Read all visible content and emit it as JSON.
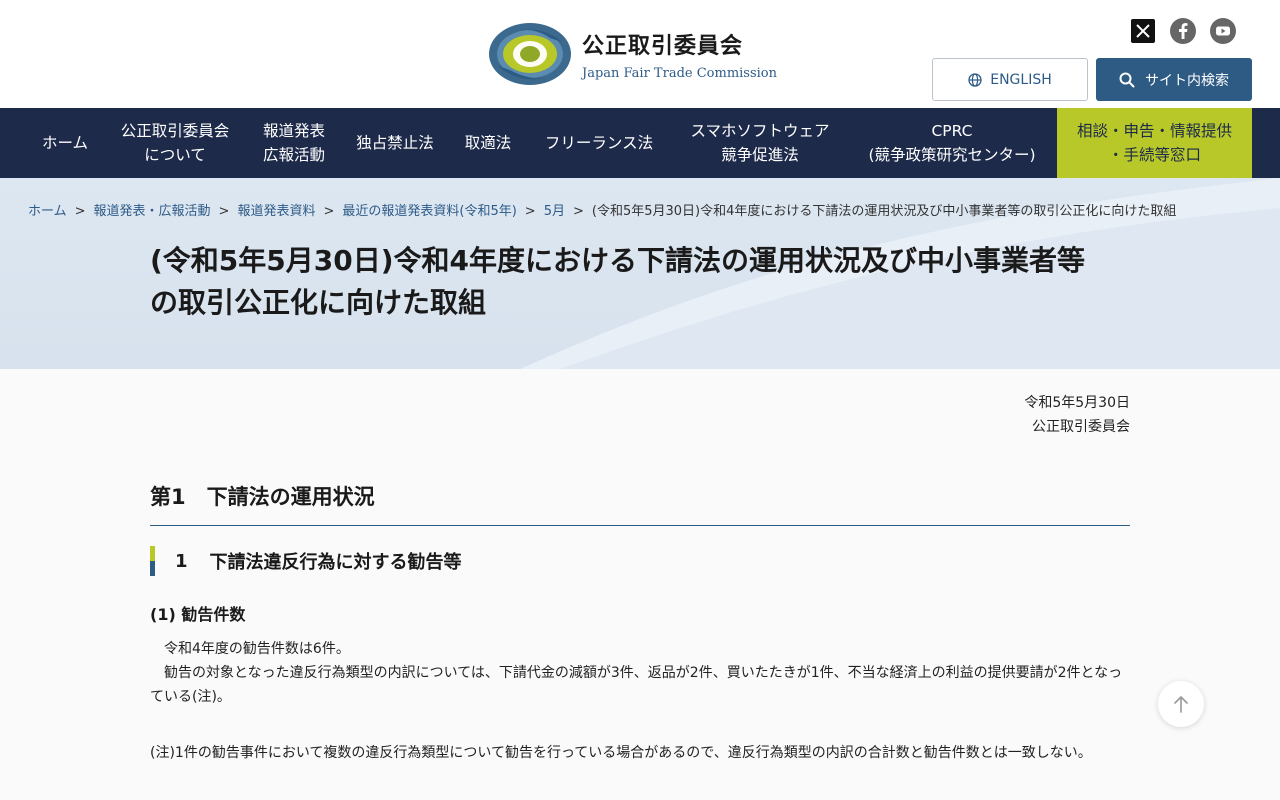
{
  "header": {
    "org_name_ja": "公正取引委員会",
    "org_name_en": "Japan Fair Trade Commission",
    "logo_ring_text": "JAPAN FAIR TRADE COMMISSION",
    "english_button": "ENGLISH",
    "search_button": "サイト内検索",
    "social": [
      "x-icon",
      "facebook-icon",
      "youtube-icon"
    ]
  },
  "nav": {
    "items": [
      {
        "line1": "ホーム",
        "line2": ""
      },
      {
        "line1": "公正取引委員会",
        "line2": "について"
      },
      {
        "line1": "報道発表",
        "line2": "広報活動"
      },
      {
        "line1": "独占禁止法",
        "line2": ""
      },
      {
        "line1": "取適法",
        "line2": ""
      },
      {
        "line1": "フリーランス法",
        "line2": ""
      },
      {
        "line1": "スマホソフトウェア",
        "line2": "競争促進法"
      },
      {
        "line1": "CPRC",
        "line2": "(競争政策研究センター)"
      },
      {
        "line1": "相談・申告・情報提供",
        "line2": "・手続等窓口"
      }
    ]
  },
  "breadcrumb": {
    "items": [
      "ホーム",
      "報道発表・広報活動",
      "報道発表資料",
      "最近の報道発表資料(令和5年)",
      "5月"
    ],
    "current": "(令和5年5月30日)令和4年度における下請法の運用状況及び中小事業者等の取引公正化に向けた取組",
    "separator": ">"
  },
  "page": {
    "title_line1": "(令和5年5月30日)令和4年度における下請法の運用状況及び中小事業者等",
    "title_line2": "の取引公正化に向けた取組",
    "date": "令和5年5月30日",
    "issuer": "公正取引委員会",
    "h2": "第1　下請法の運用状況",
    "h3_num": "1",
    "h3_text": "下請法違反行為に対する勧告等",
    "h4": "(1) 勧告件数",
    "p1_line1": "　令和4年度の勧告件数は6件。",
    "p1_line2": "　勧告の対象となった違反行為類型の内訳については、下請代金の減額が3件、返品が2件、買いたたきが1件、不当な経済上の利益の提供要請が2件となっている(注)。",
    "note": "(注)1件の勧告事件において複数の違反行為類型について勧告を行っている場合があるので、違反行為類型の内訳の合計数と勧告件数とは一致しない。"
  },
  "colors": {
    "nav_bg": "#1d2a4a",
    "accent_green": "#b7c828",
    "brand_blue": "#2e5b83"
  }
}
